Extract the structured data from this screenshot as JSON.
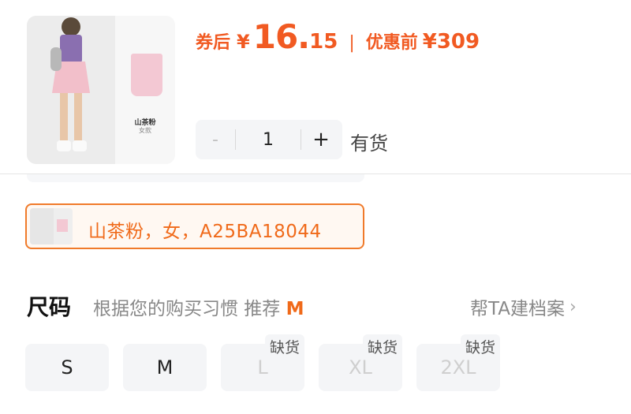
{
  "product": {
    "thumb_name": "山茶粉",
    "thumb_sub": "女款"
  },
  "price": {
    "after_label": "券后",
    "currency": "¥",
    "int": "16.",
    "dec": "15",
    "separator": "|",
    "before_label": "优惠前",
    "original": "¥309",
    "color": "#f15a22"
  },
  "stepper": {
    "minus": "-",
    "value": "1",
    "plus": "+"
  },
  "stock": "有货",
  "variant": {
    "label": "山茶粉，女，A25BA18044",
    "accent": "#f07a2a"
  },
  "size": {
    "title": "尺码",
    "tip": "根据您的购买习惯 推荐",
    "recommended": "M",
    "archive_link": "帮TA建档案",
    "options": [
      {
        "label": "S",
        "badge": ""
      },
      {
        "label": "M",
        "badge": ""
      },
      {
        "label": "L",
        "badge": "缺货"
      },
      {
        "label": "XL",
        "badge": "缺货"
      },
      {
        "label": "2XL",
        "badge": "缺货"
      }
    ]
  }
}
